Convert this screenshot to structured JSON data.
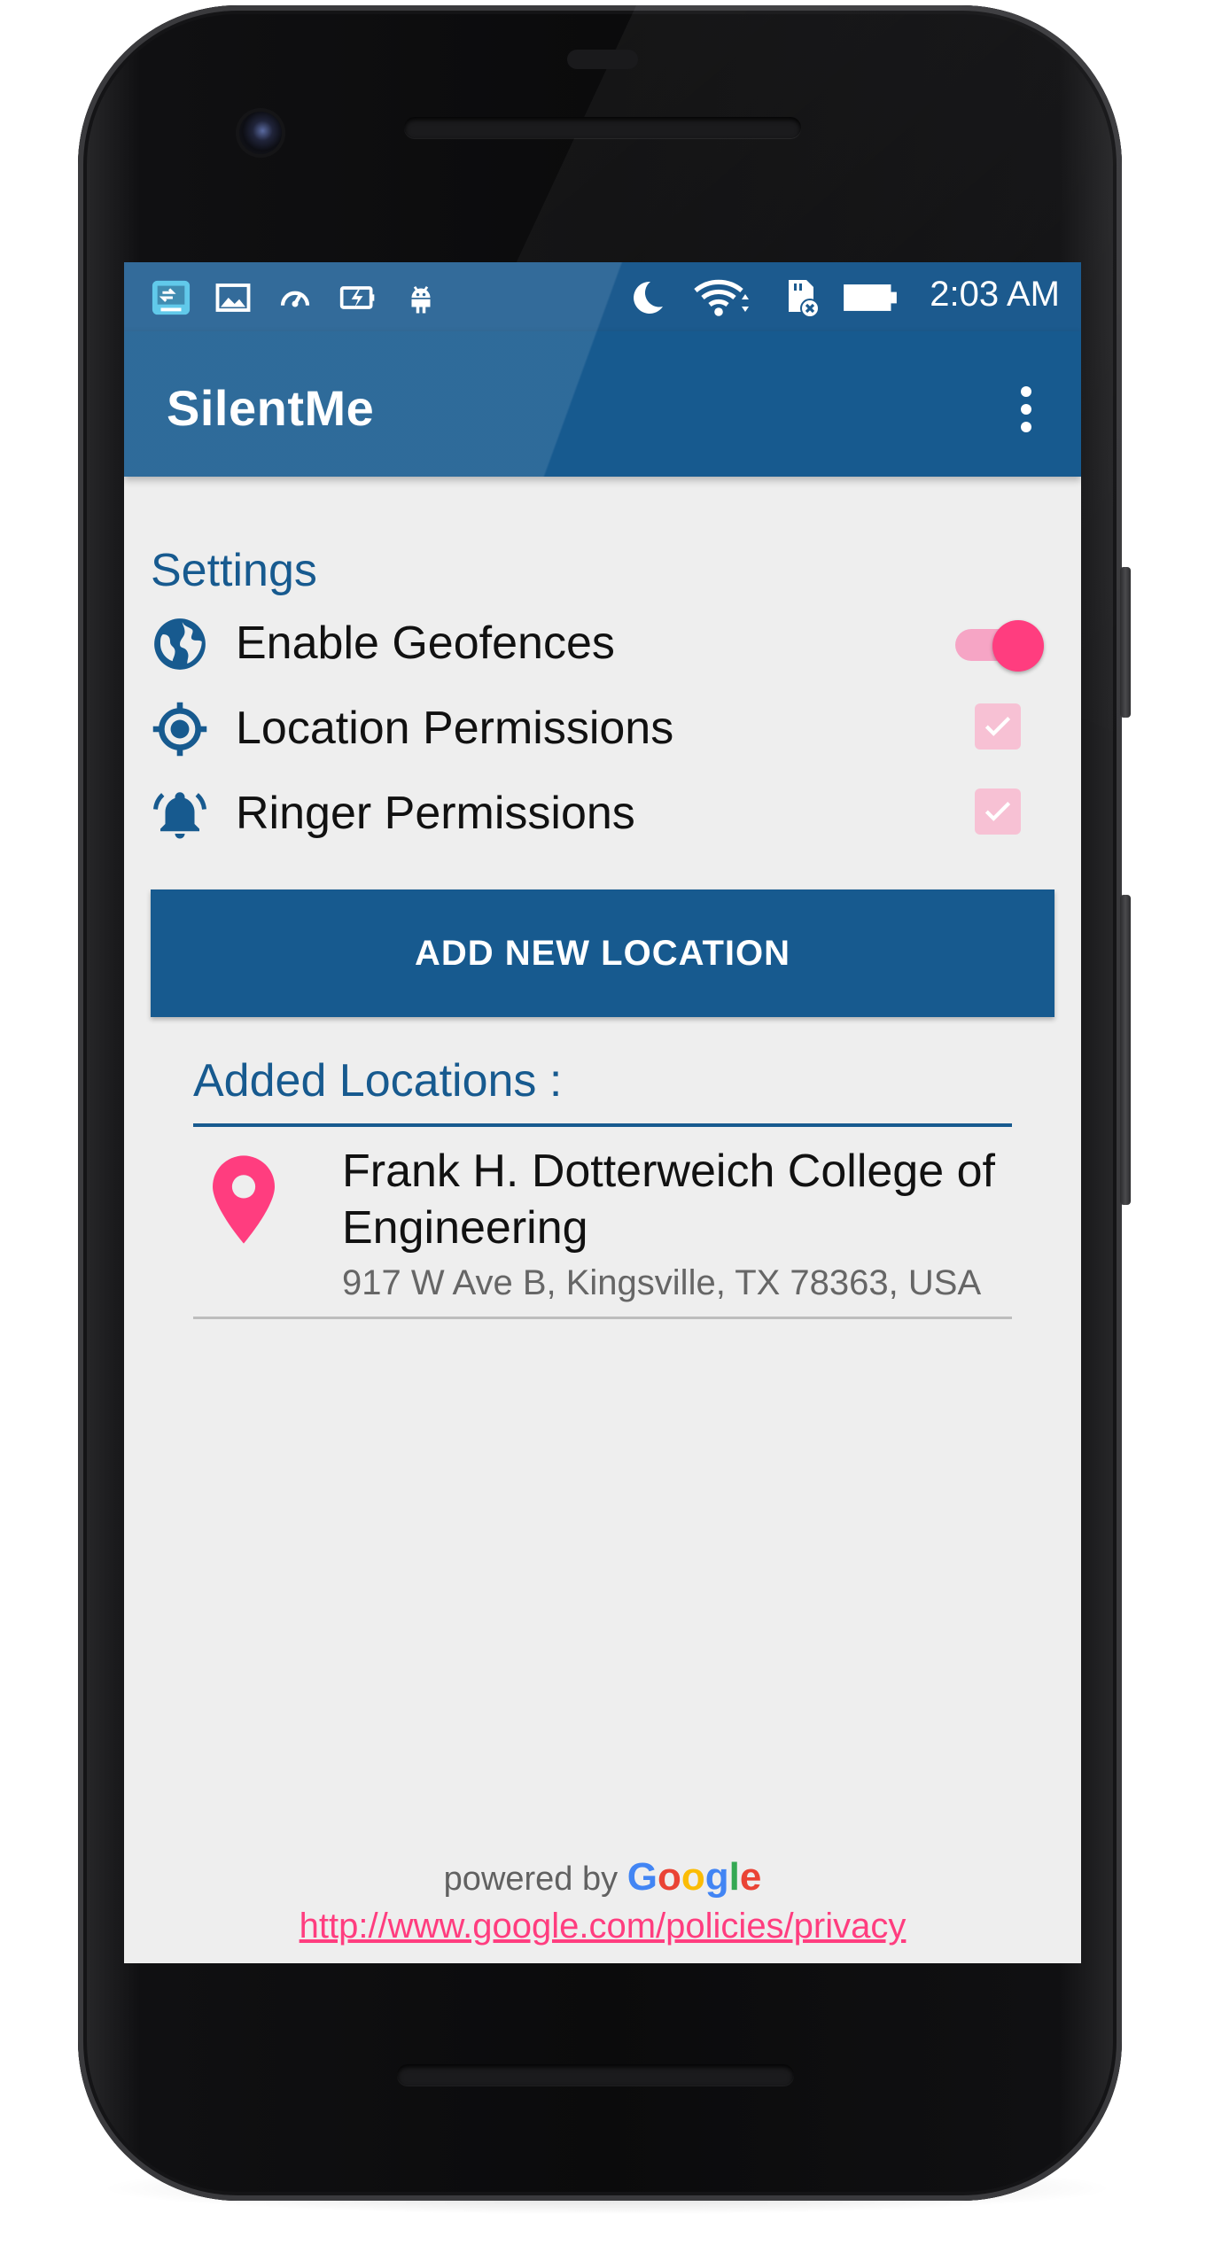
{
  "status_bar": {
    "time": "2:03 AM",
    "left_icons": [
      "screen-cast-icon",
      "image-icon",
      "speed-icon",
      "battery-saver-icon",
      "android-icon"
    ],
    "right_icons": [
      "moon-icon",
      "wifi-icon",
      "sd-card-icon",
      "battery-icon"
    ]
  },
  "app_bar": {
    "title": "SilentMe",
    "overflow_icon": "more-vert-icon"
  },
  "settings": {
    "title": "Settings",
    "items": [
      {
        "label": "Enable Geofences",
        "icon": "globe-icon",
        "control": "toggle",
        "on": true
      },
      {
        "label": "Location Permissions",
        "icon": "gps-target-icon",
        "control": "checkbox",
        "checked": true
      },
      {
        "label": "Ringer Permissions",
        "icon": "bell-icon",
        "control": "checkbox",
        "checked": true
      }
    ]
  },
  "add_button": {
    "label": "ADD NEW LOCATION"
  },
  "added_locations": {
    "title": "Added Locations :",
    "items": [
      {
        "name": "Frank H. Dotterweich College of Engineering",
        "address": "917 W Ave B, Kingsville, TX 78363, USA",
        "icon": "map-pin-icon"
      }
    ]
  },
  "footer": {
    "powered_by": "powered by",
    "brand": "Google",
    "privacy_url": "http://www.google.com/policies/privacy"
  },
  "colors": {
    "primary": "#175a8f",
    "accent": "#ff3d7f",
    "background": "#eeeeee"
  }
}
